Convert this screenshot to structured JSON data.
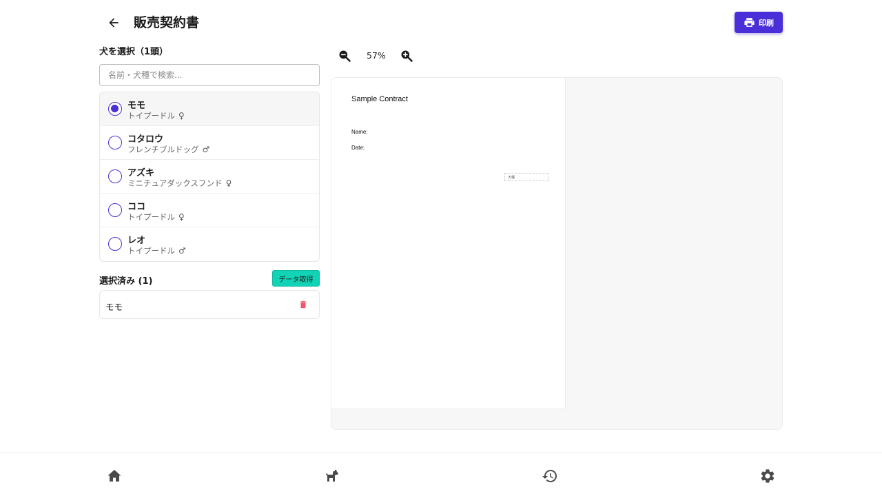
{
  "header": {
    "title": "販売契約書",
    "print_label": "印刷"
  },
  "left_panel": {
    "section_label": "犬を選択（1頭）",
    "search_placeholder": "名前・犬種で検索...",
    "dogs": [
      {
        "name": "モモ",
        "breed": "トイプードル",
        "sex": "♀",
        "selected": true
      },
      {
        "name": "コタロウ",
        "breed": "フレンチブルドッグ",
        "sex": "♂",
        "selected": false
      },
      {
        "name": "アズキ",
        "breed": "ミニチュアダックスフンド",
        "sex": "♀",
        "selected": false
      },
      {
        "name": "ココ",
        "breed": "トイプードル",
        "sex": "♀",
        "selected": false
      },
      {
        "name": "レオ",
        "breed": "トイプードル",
        "sex": "♂",
        "selected": false
      }
    ],
    "selected_title": "選択済み (1)",
    "fetch_label": "データ取得",
    "selected_items": [
      {
        "name": "モモ"
      }
    ]
  },
  "preview": {
    "zoom_level": "57%",
    "document": {
      "title": "Sample Contract",
      "name_label": "Name:",
      "date_label": "Date:",
      "box_label": "犬種"
    }
  },
  "bottom_nav": {
    "items": [
      "home-icon",
      "dog-icon",
      "history-icon",
      "gear-icon"
    ]
  },
  "colors": {
    "primary": "#4a2fd8",
    "accent": "#12d3b5",
    "danger": "#f0566e"
  }
}
